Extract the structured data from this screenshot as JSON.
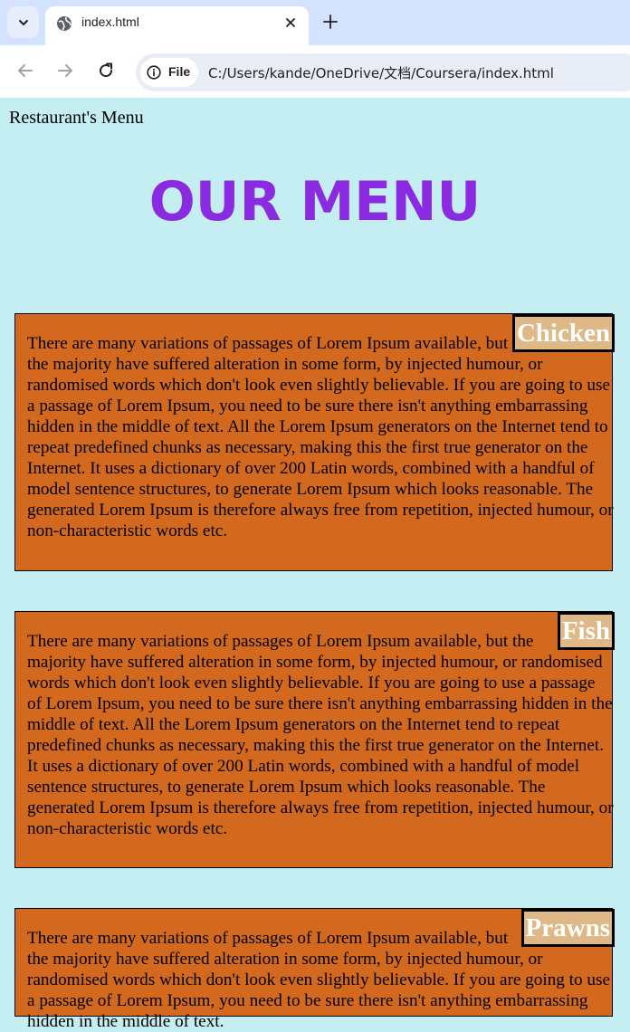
{
  "browser": {
    "tab_title": "index.html",
    "chip_label": "File",
    "url": "C:/Users/kande/OneDrive/文档/Coursera/index.html"
  },
  "page": {
    "title": "Restaurant's Menu",
    "heading": "OUR MENU",
    "items": [
      {
        "label": "Chicken",
        "text": "There are many variations of passages of Lorem Ipsum available, but the majority have suffered alteration in some form, by injected humour, or randomised words which don't look even slightly believable. If you are going to use a passage of Lorem Ipsum, you need to be sure there isn't anything embarrassing hidden in the middle of text. All the Lorem Ipsum generators on the Internet tend to repeat predefined chunks as necessary, making this the first true generator on the Internet. It uses a dictionary of over 200 Latin words, combined with a handful of model sentence structures, to generate Lorem Ipsum which looks reasonable. The generated Lorem Ipsum is therefore always free from repetition, injected humour, or non-characteristic words etc."
      },
      {
        "label": "Fish",
        "text": "There are many variations of passages of Lorem Ipsum available, but the majority have suffered alteration in some form, by injected humour, or randomised words which don't look even slightly believable. If you are going to use a passage of Lorem Ipsum, you need to be sure there isn't anything embarrassing hidden in the middle of text. All the Lorem Ipsum generators on the Internet tend to repeat predefined chunks as necessary, making this the first true generator on the Internet. It uses a dictionary of over 200 Latin words, combined with a handful of model sentence structures, to generate Lorem Ipsum which looks reasonable. The generated Lorem Ipsum is therefore always free from repetition, injected humour, or non-characteristic words etc."
      },
      {
        "label": "Prawns",
        "text": "There are many variations of passages of Lorem Ipsum available, but the majority have suffered alteration in some form, by injected humour, or randomised words which don't look even slightly believable. If you are going to use a passage of Lorem Ipsum, you need to be sure there isn't anything embarrassing hidden in the middle of text."
      }
    ]
  },
  "colors": {
    "background": "#c4eef1",
    "heading": "#8a2be2",
    "card": "#d2691e",
    "label_bg": "#deb887"
  }
}
